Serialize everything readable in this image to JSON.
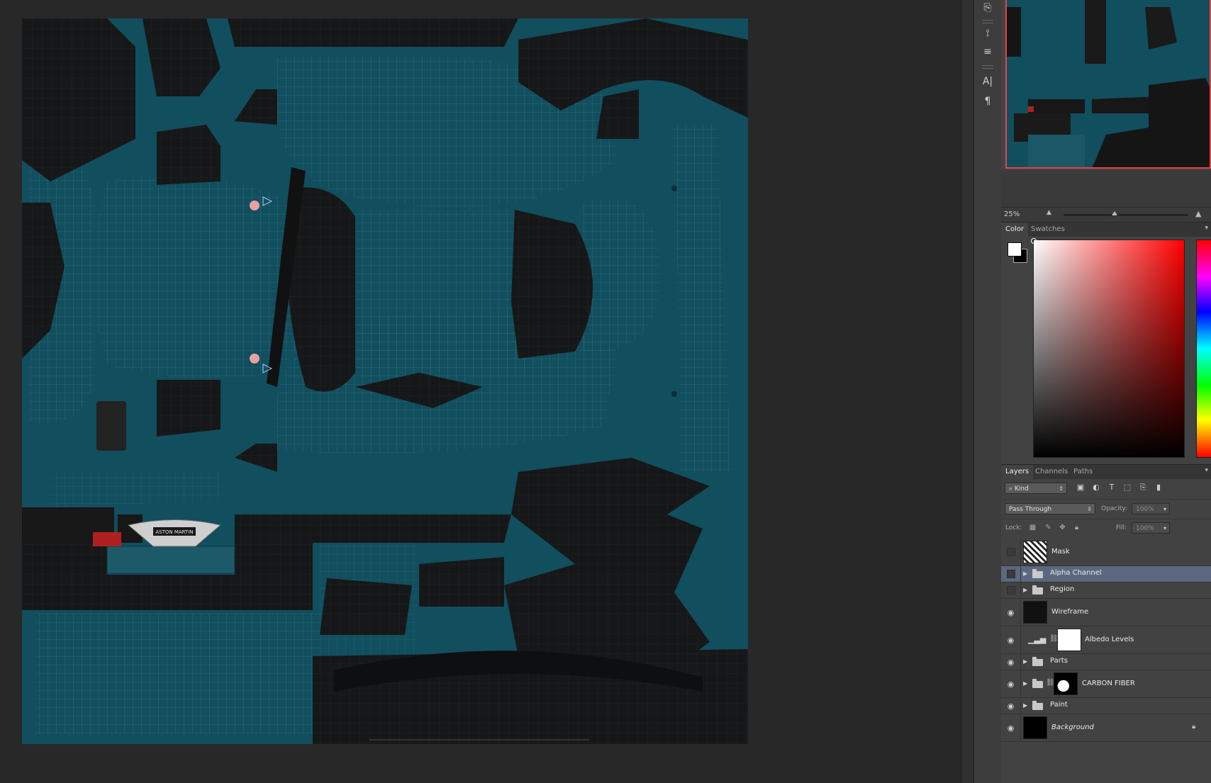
{
  "navigator": {
    "zoom": "25%"
  },
  "color_panel": {
    "tabs": [
      "Color",
      "Swatches"
    ],
    "foreground": "#ffffff",
    "background": "#000000",
    "hue_color": "#ff0000"
  },
  "layers_panel": {
    "tabs": [
      "Layers",
      "Channels",
      "Paths"
    ],
    "filter_kind": "Kind",
    "blend_mode": "Pass Through",
    "opacity_label": "Opacity:",
    "opacity_value": "100%",
    "lock_label": "Lock:",
    "fill_label": "Fill:",
    "fill_value": "100%",
    "layers": [
      {
        "name": "Mask",
        "type": "layer",
        "visible": false
      },
      {
        "name": "Alpha Channel",
        "type": "group",
        "visible": false,
        "selected": true
      },
      {
        "name": "Region",
        "type": "group",
        "visible": false
      },
      {
        "name": "Wireframe",
        "type": "layer",
        "visible": true
      },
      {
        "name": "Albedo Levels",
        "type": "adjustment",
        "visible": true
      },
      {
        "name": "Parts",
        "type": "group",
        "visible": true
      },
      {
        "name": "CARBON FIBER",
        "type": "group-mask",
        "visible": true
      },
      {
        "name": "Paint",
        "type": "group",
        "visible": true
      },
      {
        "name": "Background",
        "type": "background",
        "visible": true,
        "locked": true
      }
    ]
  },
  "canvas": {
    "document_color": "#114e5e",
    "emblem_text": "ASTON MARTIN"
  }
}
